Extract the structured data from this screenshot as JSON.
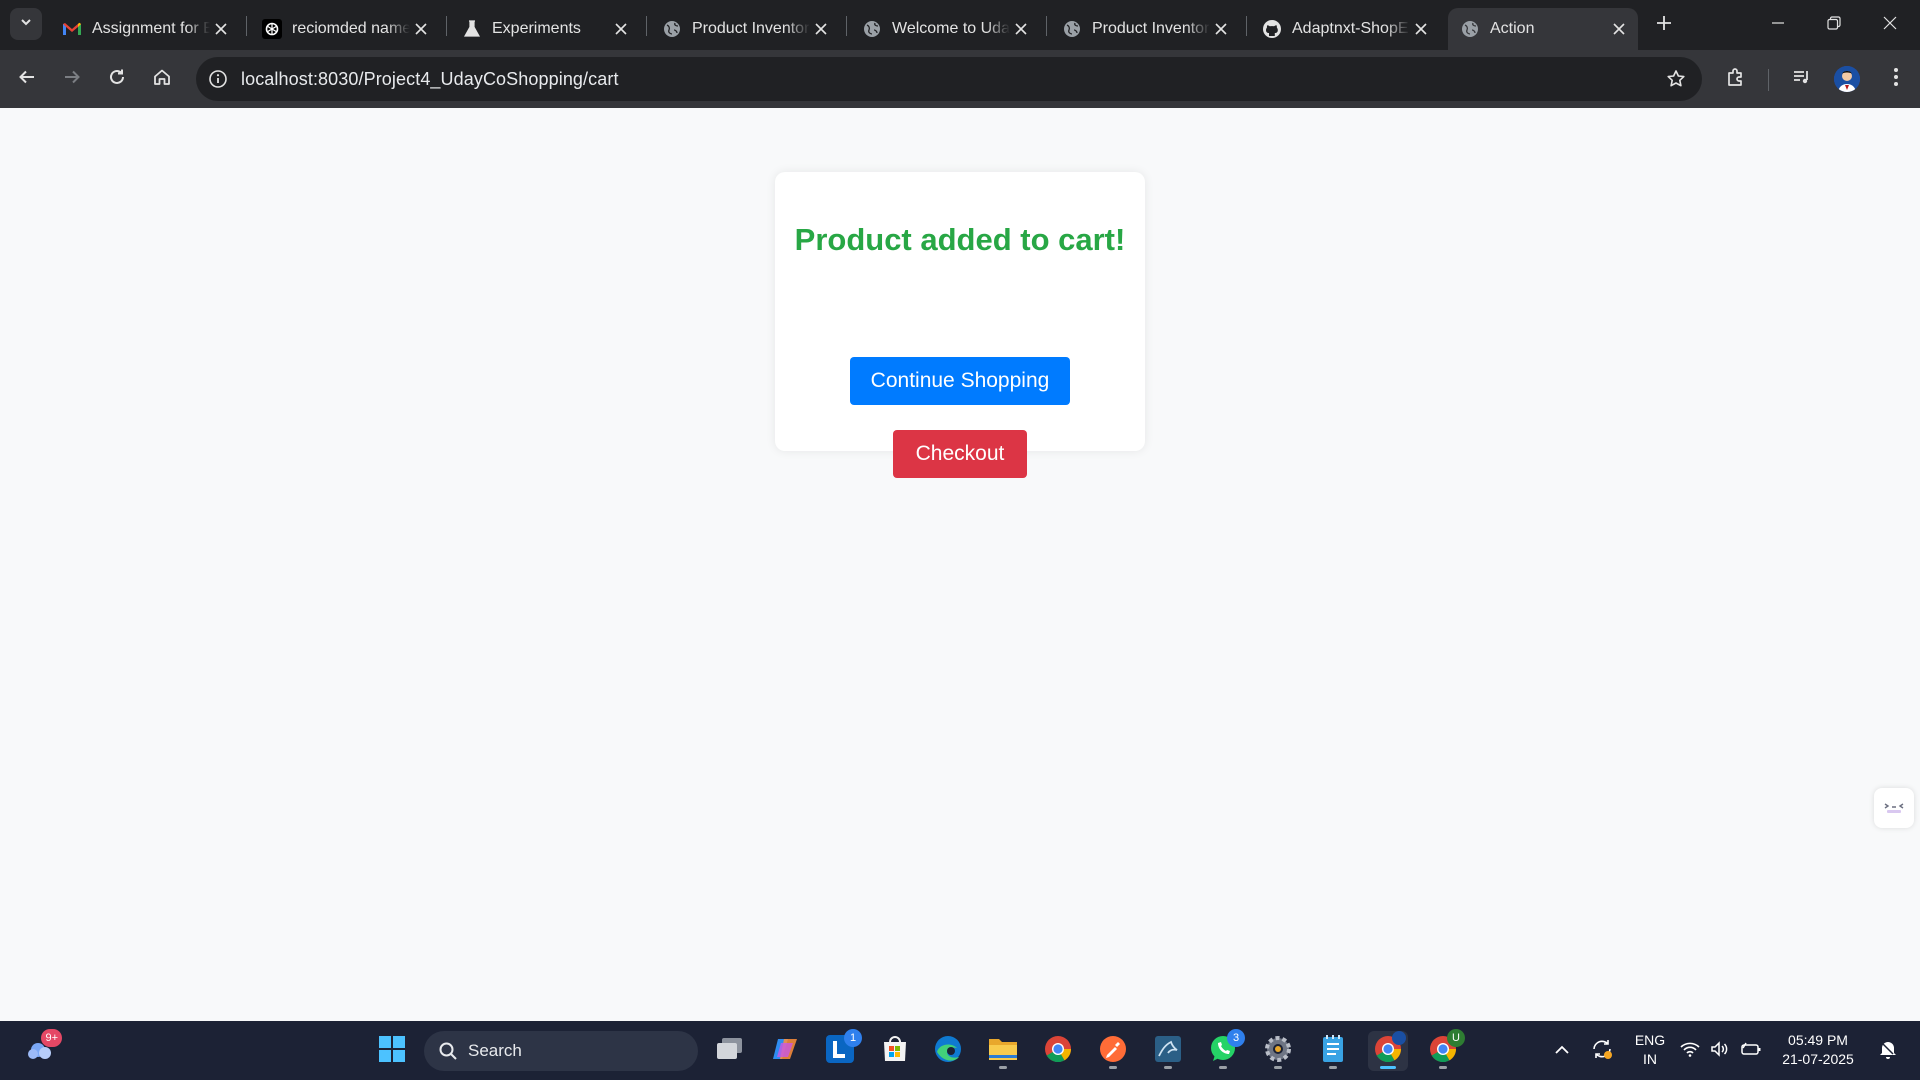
{
  "browser": {
    "tabs": [
      {
        "title": "Assignment for E",
        "icon": "gmail-icon"
      },
      {
        "title": "reciomded name",
        "icon": "openai-icon"
      },
      {
        "title": "Experiments",
        "icon": "flask-icon"
      },
      {
        "title": "Product Inventor",
        "icon": "globe-icon"
      },
      {
        "title": "Welcome to Uda",
        "icon": "globe-icon"
      },
      {
        "title": "Product Inventor",
        "icon": "globe-icon"
      },
      {
        "title": "Adaptnxt-ShopE",
        "icon": "github-icon"
      },
      {
        "title": "Action",
        "icon": "globe-icon",
        "active": true
      }
    ],
    "address": {
      "host": "localhost",
      "rest": ":8030/Project4_UdayCoShopping/cart"
    }
  },
  "page": {
    "message": "Product added to cart!",
    "continue_label": "Continue Shopping",
    "checkout_label": "Checkout",
    "colors": {
      "success": "#28a745",
      "primary": "#007bff",
      "danger": "#dc3545"
    }
  },
  "taskbar": {
    "search_label": "Search",
    "widget_badge": "9+",
    "badges": {
      "linkedin": "1",
      "whatsapp": "3",
      "chrome_profile": "U"
    },
    "language": {
      "line1": "ENG",
      "line2": "IN"
    },
    "time": "05:49 PM",
    "date": "21-07-2025"
  }
}
